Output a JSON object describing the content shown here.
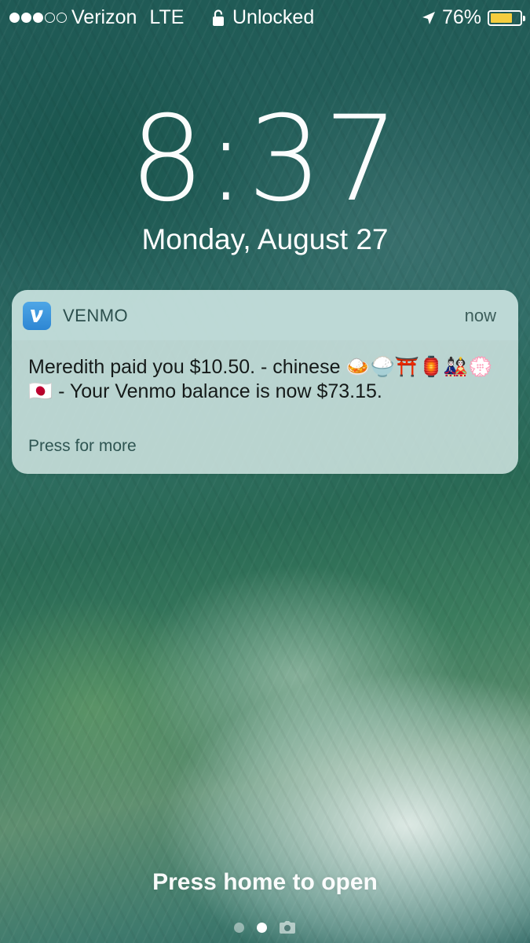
{
  "status_bar": {
    "signal_bars_filled": 3,
    "signal_bars_total": 5,
    "carrier": "Verizon",
    "network": "LTE",
    "lock_status": "Unlocked",
    "location_icon": "location-arrow-icon",
    "battery_percent_label": "76%",
    "battery_level": 0.76,
    "battery_color": "#f4cd3e"
  },
  "lock_screen": {
    "time": "8:37",
    "date": "Monday, August 27"
  },
  "notification": {
    "app_name": "VENMO",
    "app_icon": "venmo-icon",
    "app_icon_letter": "V",
    "app_icon_color": "#3d96dd",
    "time": "now",
    "message": "Meredith paid you $10.50. - chinese 🍛🍚⛩️🏮🎎💮🇯🇵 - Your Venmo balance is now $73.15.",
    "action_hint": "Press for more"
  },
  "bottom": {
    "hint": "Press home to open",
    "page_count": 2,
    "active_page": 2,
    "camera_icon": "camera-icon"
  }
}
